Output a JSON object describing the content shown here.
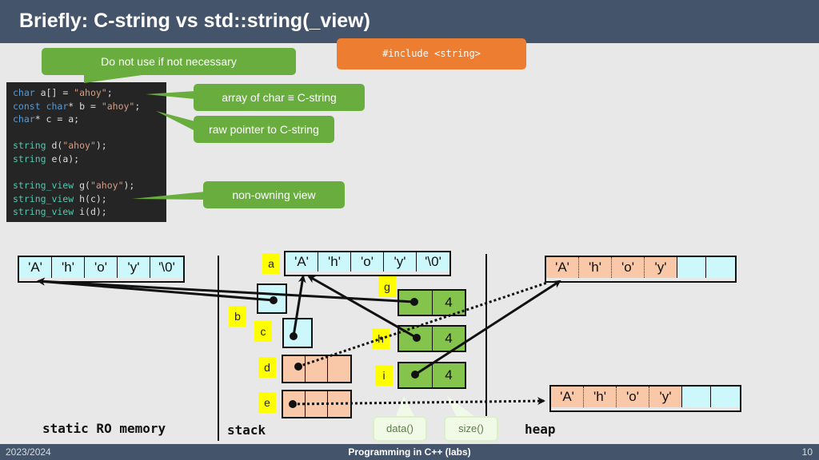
{
  "header": {
    "title": "Briefly: C-string vs std::string(_view)"
  },
  "callouts": {
    "not_necessary": "Do not use if not necessary",
    "include": "#include <string>",
    "array_of_char": "array of char ≡ C-string",
    "raw_pointer": "raw pointer to C-string",
    "non_owning": "non-owning view",
    "data": "data()",
    "size": "size()"
  },
  "code": {
    "lines": [
      [
        {
          "t": "char",
          "c": "kw"
        },
        {
          "t": " a[] = "
        },
        {
          "t": "\"ahoy\"",
          "c": "str"
        },
        {
          "t": ";"
        }
      ],
      [
        {
          "t": "const",
          "c": "kw"
        },
        {
          "t": " "
        },
        {
          "t": "char",
          "c": "kw"
        },
        {
          "t": "* b = "
        },
        {
          "t": "\"ahoy\"",
          "c": "str"
        },
        {
          "t": ";"
        }
      ],
      [
        {
          "t": "char",
          "c": "kw"
        },
        {
          "t": "* c = a;"
        }
      ],
      [],
      [
        {
          "t": "string",
          "c": "ty"
        },
        {
          "t": " d("
        },
        {
          "t": "\"ahoy\"",
          "c": "str"
        },
        {
          "t": ");"
        }
      ],
      [
        {
          "t": "string",
          "c": "ty"
        },
        {
          "t": " e(a);"
        }
      ],
      [],
      [
        {
          "t": "string_view",
          "c": "ty"
        },
        {
          "t": " g("
        },
        {
          "t": "\"ahoy\"",
          "c": "str"
        },
        {
          "t": ");"
        }
      ],
      [
        {
          "t": "string_view",
          "c": "ty"
        },
        {
          "t": " h(c);"
        }
      ],
      [
        {
          "t": "string_view",
          "c": "ty"
        },
        {
          "t": " i(d);"
        }
      ]
    ]
  },
  "memory": {
    "static_ro": [
      "'A'",
      "'h'",
      "'o'",
      "'y'",
      "'\\0'"
    ],
    "stack_array_a": [
      "'A'",
      "'h'",
      "'o'",
      "'y'",
      "'\\0'"
    ],
    "heap_d": [
      "'A'",
      "'h'",
      "'o'",
      "'y'",
      "",
      ""
    ],
    "heap_e": [
      "'A'",
      "'h'",
      "'o'",
      "'y'",
      "",
      ""
    ],
    "view_sizes": {
      "g": "4",
      "h": "4",
      "i": "4"
    },
    "var_labels": {
      "a": "a",
      "b": "b",
      "c": "c",
      "d": "d",
      "e": "e",
      "g": "g",
      "h": "h",
      "i": "i"
    },
    "regions": {
      "static": "static RO memory",
      "stack": "stack",
      "heap": "heap"
    }
  },
  "colors": {
    "header": "#44546a",
    "callout_green": "#6aad3f",
    "include_orange": "#ed7d31",
    "cell_cyan": "#ccf8fc",
    "cell_salmon": "#f8c8a8",
    "cell_green": "#84c44c",
    "label_yellow": "#ffff00"
  },
  "footer": {
    "year": "2023/2024",
    "course": "Programming in C++ (labs)",
    "page": "10"
  }
}
